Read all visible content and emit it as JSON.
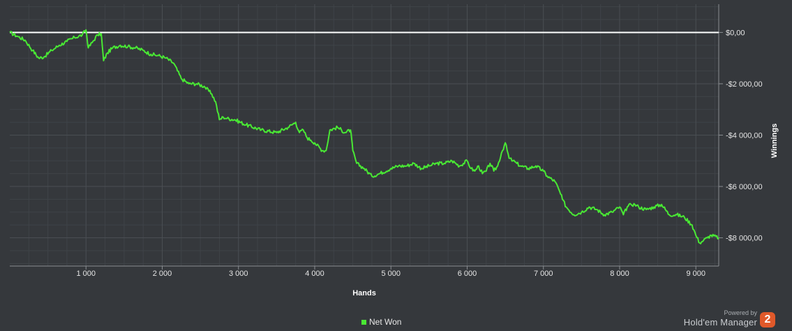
{
  "chart_data": {
    "type": "line",
    "xlabel": "Hands",
    "ylabel": "Winnings",
    "xlim": [
      0,
      9300
    ],
    "ylim": [
      -9100,
      1100
    ],
    "x_ticks": [
      1000,
      2000,
      3000,
      4000,
      5000,
      6000,
      7000,
      8000,
      9000
    ],
    "x_tick_labels": [
      "1 000",
      "2 000",
      "3 000",
      "4 000",
      "5 000",
      "6 000",
      "7 000",
      "8 000",
      "9 000"
    ],
    "y_ticks": [
      0,
      -2000,
      -4000,
      -6000,
      -8000
    ],
    "y_tick_labels": [
      "$0,00",
      "-$2 000,00",
      "-$4 000,00",
      "-$6 000,00",
      "-$8 000,00"
    ],
    "grid": true,
    "legend": "bottom-center",
    "zero_line_color": "#ffffff",
    "series": [
      {
        "name": "Net Won",
        "color": "#49e834",
        "x": [
          0,
          100,
          200,
          300,
          380,
          450,
          550,
          650,
          750,
          850,
          950,
          1000,
          1030,
          1080,
          1150,
          1200,
          1230,
          1280,
          1350,
          1450,
          1550,
          1650,
          1750,
          1850,
          1950,
          2050,
          2150,
          2250,
          2350,
          2450,
          2550,
          2650,
          2700,
          2750,
          2800,
          2850,
          2950,
          3100,
          3300,
          3500,
          3650,
          3750,
          3800,
          3850,
          3900,
          3950,
          4000,
          4100,
          4150,
          4200,
          4300,
          4400,
          4470,
          4500,
          4550,
          4650,
          4750,
          4850,
          5000,
          5100,
          5200,
          5300,
          5400,
          5500,
          5600,
          5700,
          5800,
          5900,
          6000,
          6050,
          6100,
          6150,
          6200,
          6250,
          6300,
          6350,
          6400,
          6450,
          6500,
          6550,
          6600,
          6650,
          6700,
          6800,
          6900,
          7000,
          7050,
          7150,
          7200,
          7250,
          7300,
          7400,
          7500,
          7600,
          7700,
          7800,
          7900,
          8000,
          8050,
          8100,
          8150,
          8200,
          8250,
          8350,
          8450,
          8550,
          8650,
          8750,
          8850,
          8950,
          9000,
          9050,
          9100,
          9150,
          9200,
          9300
        ],
        "y": [
          0,
          -150,
          -300,
          -700,
          -1000,
          -950,
          -700,
          -500,
          -350,
          -200,
          -100,
          100,
          -600,
          -400,
          -100,
          -50,
          -1100,
          -800,
          -600,
          -500,
          -550,
          -600,
          -700,
          -850,
          -900,
          -1000,
          -1200,
          -1800,
          -2000,
          -2000,
          -2100,
          -2400,
          -2700,
          -3400,
          -3300,
          -3350,
          -3400,
          -3600,
          -3800,
          -3900,
          -3700,
          -3500,
          -3900,
          -3800,
          -4100,
          -4200,
          -4300,
          -4600,
          -4600,
          -3800,
          -3700,
          -3900,
          -3800,
          -4600,
          -5100,
          -5300,
          -5600,
          -5500,
          -5300,
          -5200,
          -5200,
          -5100,
          -5300,
          -5200,
          -5100,
          -5100,
          -5000,
          -5200,
          -5000,
          -5300,
          -5400,
          -5200,
          -5500,
          -5400,
          -5100,
          -5400,
          -5200,
          -4700,
          -4300,
          -4900,
          -5000,
          -5100,
          -5200,
          -5300,
          -5200,
          -5400,
          -5600,
          -5800,
          -6100,
          -6500,
          -6800,
          -7100,
          -7000,
          -6800,
          -6900,
          -7100,
          -7000,
          -6800,
          -7100,
          -6800,
          -6700,
          -6700,
          -6800,
          -6900,
          -6800,
          -6700,
          -7100,
          -7100,
          -7200,
          -7500,
          -7900,
          -8200,
          -8100,
          -8000,
          -7900,
          -8000
        ]
      }
    ]
  },
  "legend": {
    "label": "Net Won"
  },
  "brand": {
    "powered_by": "Powered by",
    "name": "Hold'em Manager",
    "badge": "2"
  }
}
